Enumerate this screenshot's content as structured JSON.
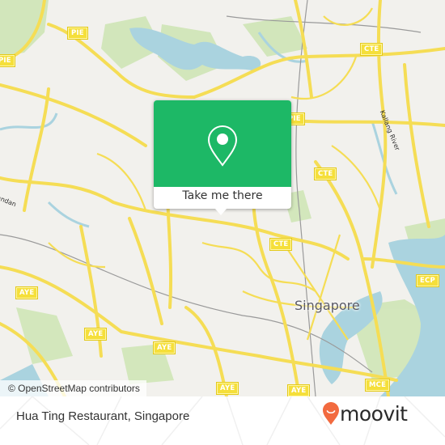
{
  "map": {
    "city_label": "Singapore",
    "street_labels": [
      "Kallang River",
      "Pandan"
    ],
    "highway_shields": [
      {
        "label": "PIE",
        "pos": "top-left"
      },
      {
        "label": "PIE",
        "pos": "left-edge"
      },
      {
        "label": "CTE",
        "pos": "top-right"
      },
      {
        "label": "PIE",
        "pos": "center-top"
      },
      {
        "label": "CTE",
        "pos": "center-right"
      },
      {
        "label": "CTE",
        "pos": "center"
      },
      {
        "label": "ECP",
        "pos": "right"
      },
      {
        "label": "AYE",
        "pos": "left"
      },
      {
        "label": "AYE",
        "pos": "left-lower"
      },
      {
        "label": "AYE",
        "pos": "center-lower"
      },
      {
        "label": "AYE",
        "pos": "bottom"
      },
      {
        "label": "AYE",
        "pos": "bottom-right"
      },
      {
        "label": "MCE",
        "pos": "bottom-right-edge"
      }
    ],
    "attribution": "© OpenStreetMap contributors",
    "colors": {
      "land": "#f2f1ed",
      "water": "#aad3df",
      "park": "#cde6b4",
      "road": "#f7e36a"
    }
  },
  "popup": {
    "icon": "map-pin-icon",
    "button_label": "Take me there",
    "color": "#1db866"
  },
  "footer": {
    "place_name": "Hua Ting Restaurant, Singapore",
    "brand": "moovit",
    "brand_color": "#f26a3f"
  }
}
